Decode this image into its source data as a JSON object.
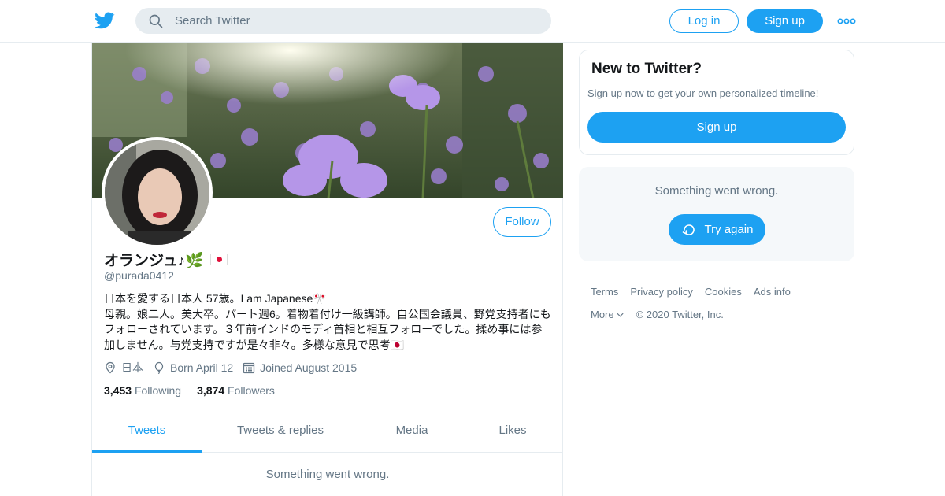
{
  "header": {
    "search_placeholder": "Search Twitter",
    "login_label": "Log in",
    "signup_label": "Sign up"
  },
  "profile": {
    "follow_label": "Follow",
    "display_name": "オランジュ♪🌿",
    "handle": "@purada0412",
    "bio": "日本を愛する日本人 57歳。I am Japanese🎌\n母親。娘二人。美大卒。パート週6。着物着付け一級講師。自公国会議員、野党支持者にもフォローされています。３年前インドのモディ首相と相互フォローでした。揉め事には参加しません。与党支持ですが是々非々。多様な意見で思考🇯🇵",
    "location": "日本",
    "born": "Born April 12",
    "joined": "Joined August 2015",
    "following_count": "3,453",
    "following_label": "Following",
    "followers_count": "3,874",
    "followers_label": "Followers"
  },
  "tabs": [
    {
      "label": "Tweets",
      "active": true
    },
    {
      "label": "Tweets & replies",
      "active": false
    },
    {
      "label": "Media",
      "active": false
    },
    {
      "label": "Likes",
      "active": false
    }
  ],
  "timeline": {
    "error_text": "Something went wrong."
  },
  "sidebar": {
    "new_title": "New to Twitter?",
    "new_text": "Sign up now to get your own personalized timeline!",
    "new_signup_label": "Sign up",
    "error_text": "Something went wrong.",
    "try_again_label": "Try again"
  },
  "footer": {
    "links": [
      "Terms",
      "Privacy policy",
      "Cookies",
      "Ads info"
    ],
    "more_label": "More",
    "copyright": "© 2020 Twitter, Inc."
  },
  "colors": {
    "accent": "#1da1f2",
    "muted": "#657786",
    "border": "#e6ecf0"
  },
  "icons": [
    "twitter-bird-icon",
    "search-icon",
    "more-dots-icon",
    "location-pin-icon",
    "balloon-icon",
    "calendar-icon",
    "refresh-icon",
    "chevron-down-icon"
  ]
}
